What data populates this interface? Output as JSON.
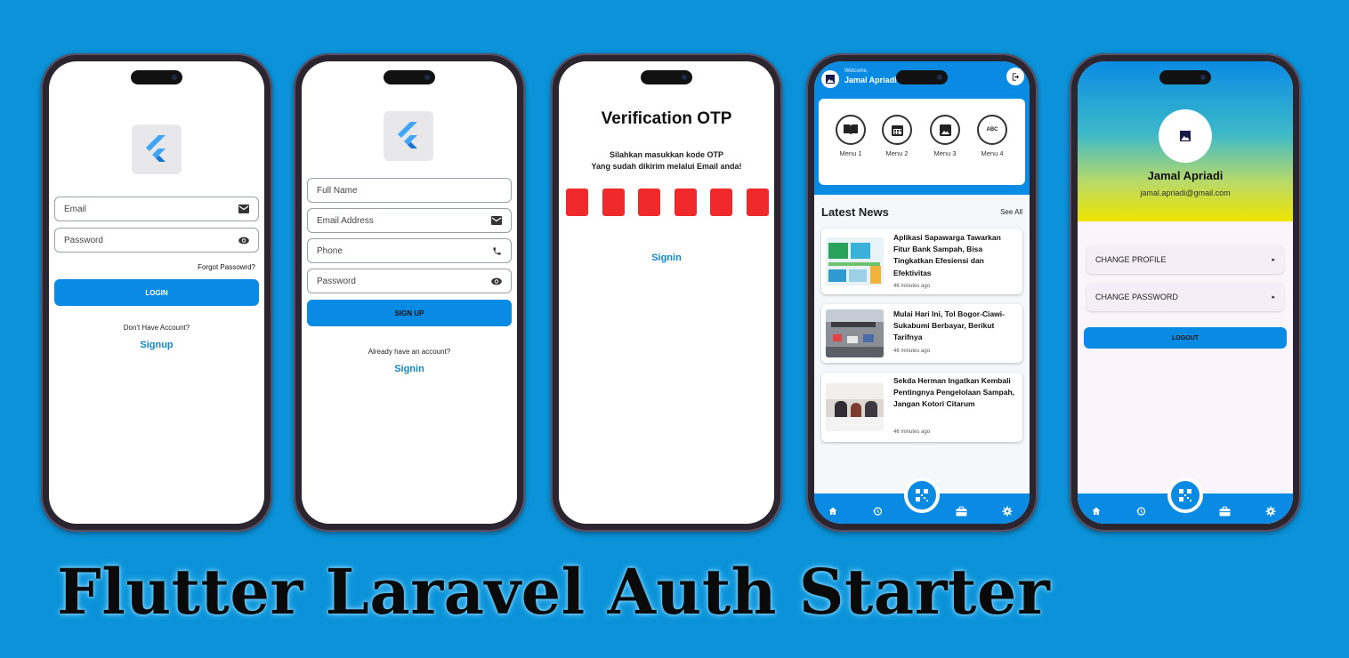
{
  "login_screen": {
    "email_placeholder": "Email",
    "password_placeholder": "Password",
    "forgot_password": "Forgot Passowrd?",
    "login_button": "LOGIN",
    "no_account_text": "Don't Have Account?",
    "signup_link": "Signup"
  },
  "signup_screen": {
    "fullname_placeholder": "Full Name",
    "email_placeholder": "Email Address",
    "phone_placeholder": "Phone",
    "password_placeholder": "Password",
    "signup_button": "SIGN UP",
    "have_account_text": "Already have an account?",
    "signin_link": "Signin"
  },
  "otp_screen": {
    "title": "Verification OTP",
    "instruction_line1": "Silahkan masukkan kode OTP",
    "instruction_line2": "Yang sudah dikirim melalui Email anda!",
    "digit_count": 6,
    "box_color": "#f02a2a",
    "signin_link": "Signin"
  },
  "home_screen": {
    "welcome_label": "Welcome,",
    "user_name": "Jamal Apriadi",
    "menus": [
      {
        "label": "Menu 1",
        "icon": "book-icon"
      },
      {
        "label": "Menu 2",
        "icon": "calendar-icon"
      },
      {
        "label": "Menu 3",
        "icon": "image-icon"
      },
      {
        "label": "Menu 4",
        "icon": "abc-icon"
      }
    ],
    "latest_news_title": "Latest News",
    "see_all": "See All",
    "news": [
      {
        "title": "Aplikasi Sapawarga Tawarkan Fitur Bank Sampah, Bisa Tingkatkan Efesiensi dan Efektivitas",
        "time": "46 minutes ago"
      },
      {
        "title": "Mulai Hari Ini, Tol Bogor-Ciawi-Sukabumi Berbayar, Berikut Tarifnya",
        "time": "46 minutes ago"
      },
      {
        "title": "Sekda Herman Ingatkan Kembali Pentingnya Pengelolaan Sampah, Jangan Kotori Citarum",
        "time": "46 minutes ago"
      }
    ],
    "nav_icons": [
      "home-icon",
      "history-icon",
      "qr-icon",
      "briefcase-icon",
      "gear-icon"
    ]
  },
  "profile_screen": {
    "name": "Jamal Apriadi",
    "email": "jamal.apriadi@gmail.com",
    "change_profile": "CHANGE PROFILE",
    "change_password": "CHANGE PASSWORD",
    "logout_button": "LOGOUT"
  },
  "colors": {
    "background": "#0b92d8",
    "primary": "#0a8be3",
    "otp_box": "#f02a2a"
  },
  "banner": {
    "title": "Flutter Laravel Auth Starter"
  }
}
